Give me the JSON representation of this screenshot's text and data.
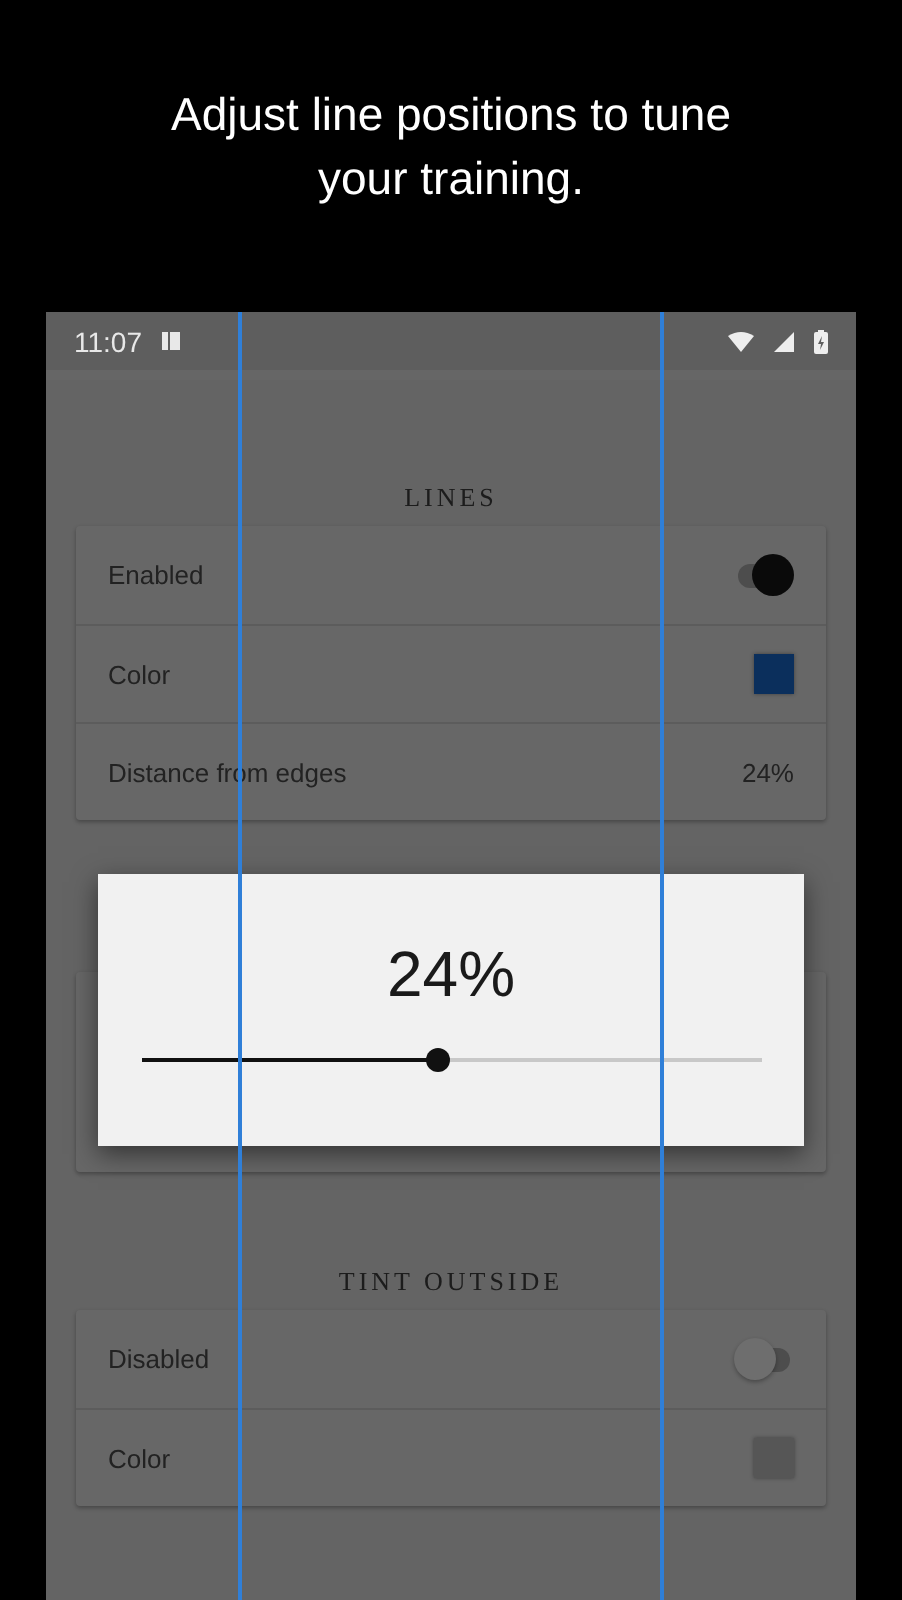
{
  "headline": "Adjust line positions to tune your training.",
  "status_bar": {
    "time": "11:07"
  },
  "sections": [
    {
      "title": "LINES",
      "rows": [
        {
          "kind": "toggle",
          "label": "Enabled",
          "on": true
        },
        {
          "kind": "color",
          "label": "Color",
          "color": "#0b2f5c"
        },
        {
          "kind": "value",
          "label": "Distance from edges",
          "value": "24%"
        }
      ]
    },
    {
      "title": "TINT OUTSIDE",
      "rows": [
        {
          "kind": "toggle",
          "label": "Disabled",
          "on": false
        },
        {
          "kind": "color",
          "label": "Color",
          "color": "#565656"
        }
      ]
    }
  ],
  "dialog": {
    "value": "24%",
    "level": 0.48
  }
}
